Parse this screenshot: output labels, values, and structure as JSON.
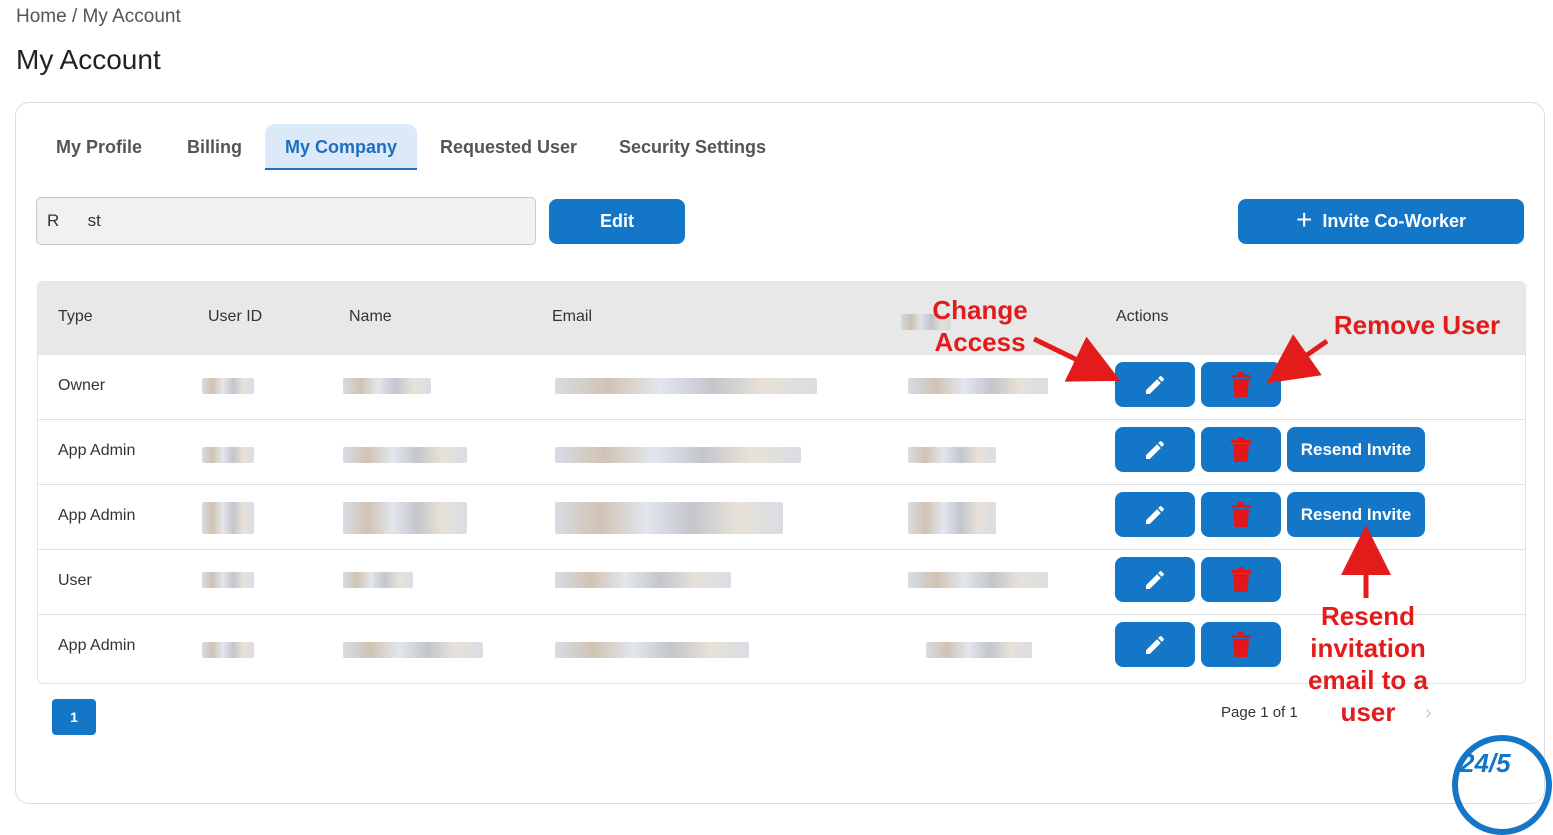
{
  "breadcrumb": {
    "home": "Home",
    "separator": "/",
    "current": "My Account"
  },
  "page_title": "My Account",
  "tabs": [
    {
      "label": "My Profile",
      "active": false
    },
    {
      "label": "Billing",
      "active": false
    },
    {
      "label": "My Company",
      "active": true
    },
    {
      "label": "Requested User",
      "active": false
    },
    {
      "label": "Security Settings",
      "active": false
    }
  ],
  "company": {
    "name_value": "R      st",
    "edit_label": "Edit"
  },
  "invite": {
    "label": "Invite Co-Worker",
    "icon": "plus-icon"
  },
  "table": {
    "headers": {
      "type": "Type",
      "user_id": "User ID",
      "name": "Name",
      "email": "Email",
      "access": "",
      "actions": "Actions"
    },
    "rows": [
      {
        "type": "Owner",
        "resend": ""
      },
      {
        "type": "App Admin",
        "resend": "Resend Invite"
      },
      {
        "type": "App Admin",
        "resend": "Resend Invite"
      },
      {
        "type": "User",
        "resend": ""
      },
      {
        "type": "App Admin",
        "resend": ""
      }
    ]
  },
  "pagination": {
    "current_page": "1",
    "info": "Page 1 of 1"
  },
  "annotations": {
    "change_access": "Change Access",
    "remove_user": "Remove User",
    "resend_help": "Resend invitation email to a user"
  },
  "colors": {
    "primary": "#1476c6",
    "trash": "#e3161b",
    "annotation": "#e31b1b",
    "tab_active_bg": "#dce9f8"
  },
  "logo_text": "24/5"
}
